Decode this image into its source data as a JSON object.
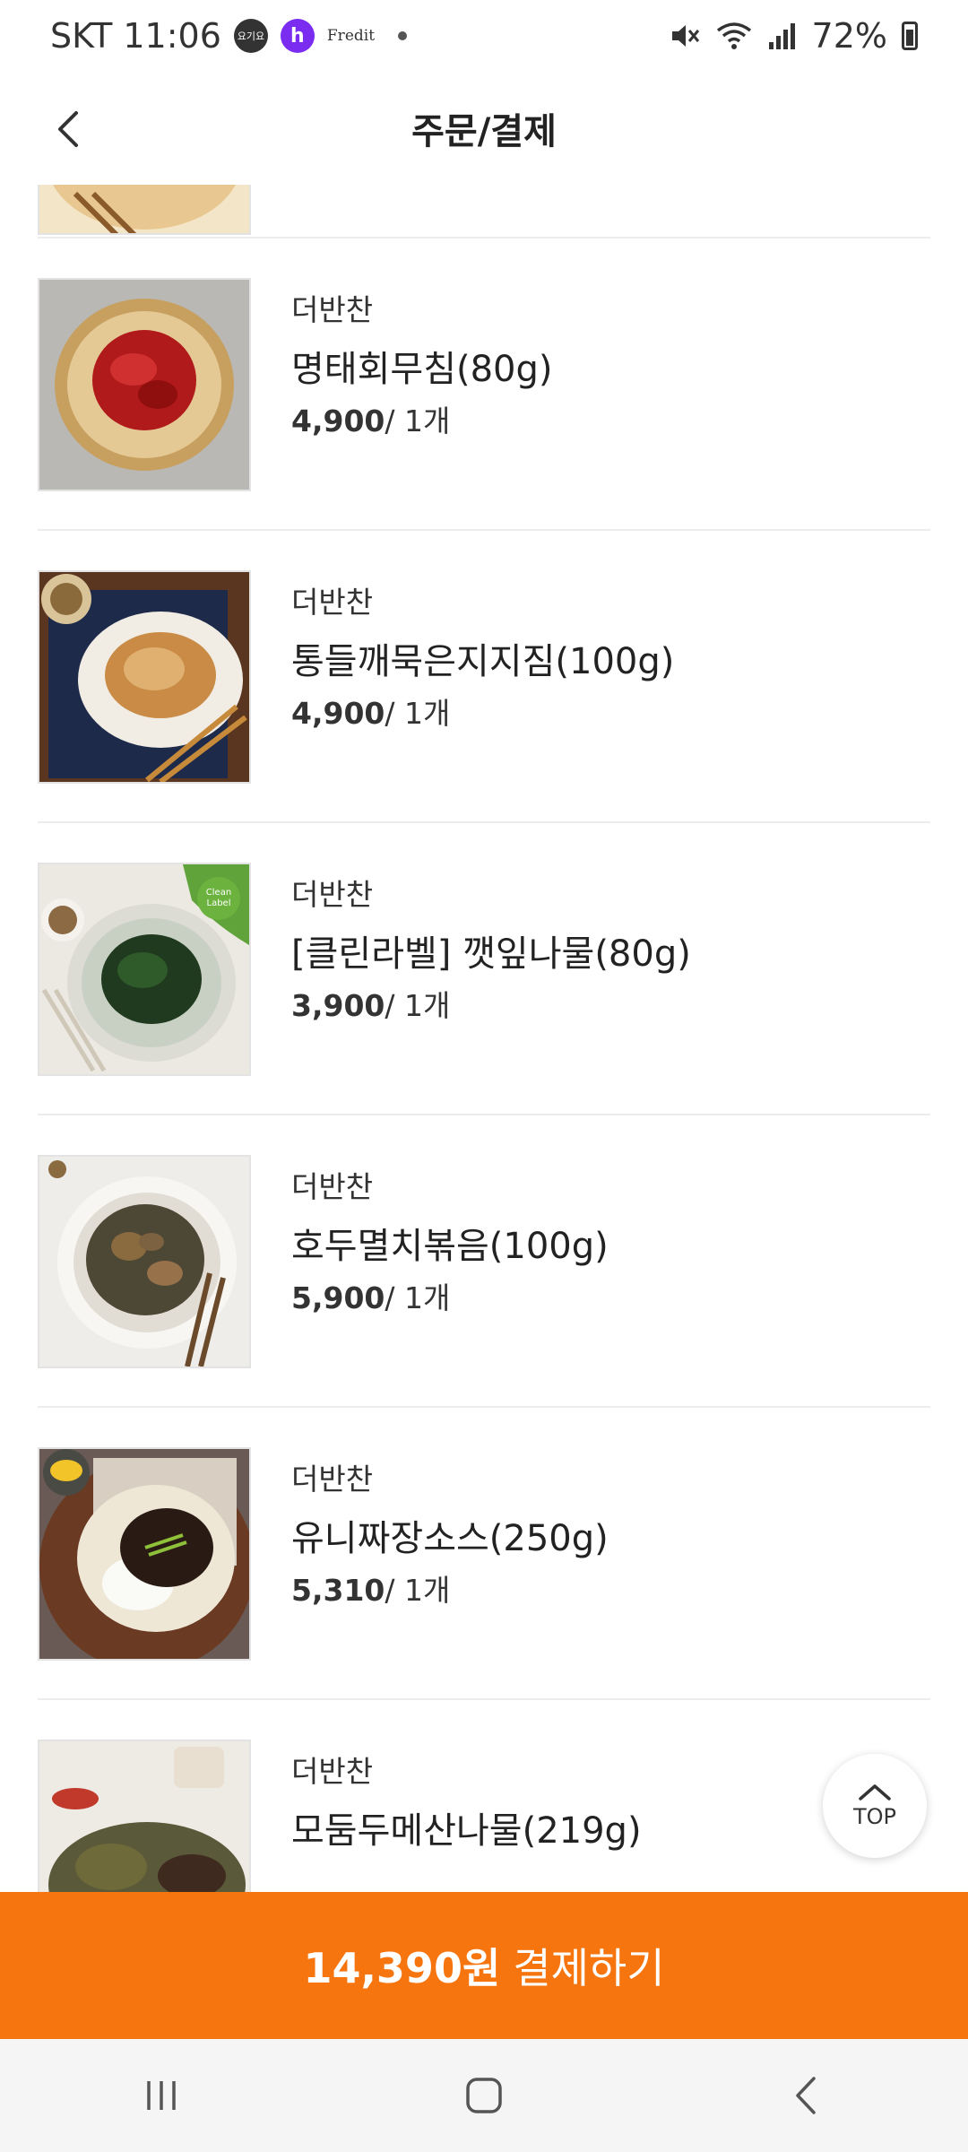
{
  "status_bar": {
    "carrier_time": "SKT 11:06",
    "badge1": "요기요",
    "badge2": "h",
    "app_name": "Fredit",
    "battery": "72%"
  },
  "header": {
    "title": "주문/결제"
  },
  "items": [
    {
      "brand": "더반찬",
      "name": "명태회무침(80g)",
      "price": "4,900",
      "qty": "/ 1개"
    },
    {
      "brand": "더반찬",
      "name": "통들깨묵은지지짐(100g)",
      "price": "4,900",
      "qty": "/ 1개"
    },
    {
      "brand": "더반찬",
      "name": "[클린라벨] 깻잎나물(80g)",
      "price": "3,900",
      "qty": "/ 1개"
    },
    {
      "brand": "더반찬",
      "name": "호두멸치볶음(100g)",
      "price": "5,900",
      "qty": "/ 1개"
    },
    {
      "brand": "더반찬",
      "name": "유니짜장소스(250g)",
      "price": "5,310",
      "qty": "/ 1개"
    },
    {
      "brand": "더반찬",
      "name": "모둠두메산나물(219g)",
      "price": "",
      "qty": ""
    }
  ],
  "top_button": {
    "label": "TOP"
  },
  "pay_bar": {
    "total": "14,390원",
    "label": "결제하기"
  },
  "colors": {
    "accent": "#f6750f",
    "divider": "#ececec"
  },
  "icons": [
    "back-arrow-icon",
    "mute-icon",
    "wifi-icon",
    "signal-icon",
    "battery-icon",
    "chevron-up-icon",
    "recent-apps-icon",
    "home-icon",
    "nav-back-icon"
  ]
}
